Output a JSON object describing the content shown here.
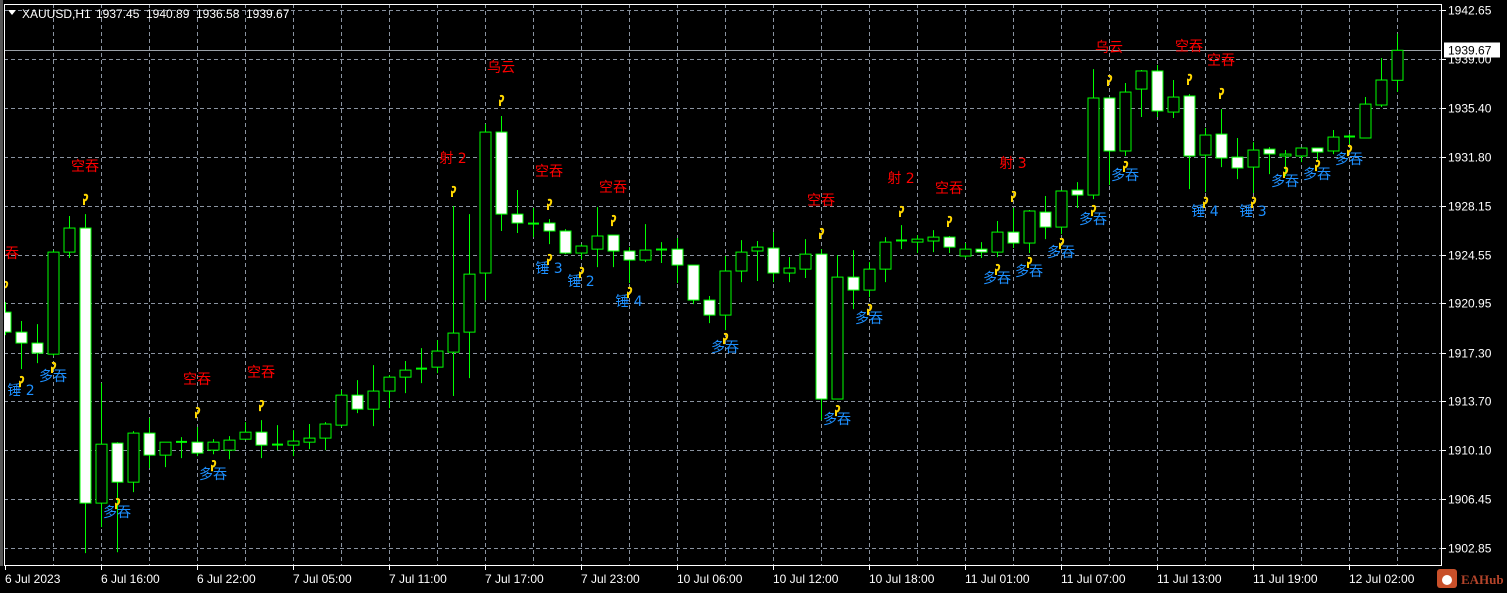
{
  "header": {
    "symbol": "XAUUSD,H1",
    "open": "1937.45",
    "high": "1940.89",
    "low": "1936.58",
    "close": "1939.67"
  },
  "current_price_label": "1939.67",
  "logo_text": "EAHub",
  "colors": {
    "background": "#000000",
    "candle_outline": "#00ff00",
    "bull_fill": "#000000",
    "bear_fill": "#ffffff",
    "grid": "#8a93a0",
    "bear_signal": "#ff0000",
    "bull_signal": "#1e90ff",
    "marker": "#ffd700"
  },
  "chart_data": {
    "type": "candlestick",
    "symbol": "XAUUSD",
    "timeframe": "H1",
    "ylim": [
      1902.85,
      1942.65
    ],
    "price_ticks": [
      "1942.65",
      "1939.00",
      "1935.40",
      "1931.80",
      "1928.15",
      "1924.55",
      "1920.95",
      "1917.30",
      "1913.70",
      "1910.10",
      "1906.45",
      "1902.85"
    ],
    "time_labels": [
      "6 Jul 2023",
      "6 Jul 16:00",
      "6 Jul 22:00",
      "7 Jul 05:00",
      "7 Jul 11:00",
      "7 Jul 17:00",
      "7 Jul 23:00",
      "10 Jul 06:00",
      "10 Jul 12:00",
      "10 Jul 18:00",
      "11 Jul 01:00",
      "11 Jul 07:00",
      "11 Jul 13:00",
      "11 Jul 19:00",
      "12 Jul 02:00"
    ],
    "bars_per_time_label": 6,
    "ohlc": [
      [
        1920.3,
        1921.04,
        1918.6,
        1918.82
      ],
      [
        1918.82,
        1919.64,
        1916.08,
        1918.01
      ],
      [
        1918.01,
        1919.41,
        1916.53,
        1917.27
      ],
      [
        1917.19,
        1924.89,
        1917.05,
        1924.74
      ],
      [
        1924.74,
        1927.41,
        1924.3,
        1926.52
      ],
      [
        1926.52,
        1927.55,
        1902.47,
        1906.17
      ],
      [
        1906.17,
        1915.05,
        1904.39,
        1910.53
      ],
      [
        1910.61,
        1910.68,
        1902.54,
        1907.72
      ],
      [
        1907.72,
        1911.5,
        1906.98,
        1911.35
      ],
      [
        1911.35,
        1912.46,
        1908.76,
        1909.72
      ],
      [
        1909.72,
        1910.68,
        1908.83,
        1910.68
      ],
      [
        1910.68,
        1911.05,
        1909.5,
        1910.7
      ],
      [
        1910.68,
        1911.79,
        1909.65,
        1909.87
      ],
      [
        1910.09,
        1910.9,
        1909.79,
        1910.68
      ],
      [
        1910.09,
        1911.13,
        1909.42,
        1910.83
      ],
      [
        1910.9,
        1912.16,
        1910.9,
        1911.42
      ],
      [
        1911.42,
        1912.31,
        1909.5,
        1910.46
      ],
      [
        1910.46,
        1911.94,
        1910.09,
        1910.5
      ],
      [
        1910.46,
        1911.57,
        1909.65,
        1910.76
      ],
      [
        1910.68,
        1912.02,
        1910.16,
        1910.98
      ],
      [
        1910.98,
        1912.16,
        1910.09,
        1912.02
      ],
      [
        1911.94,
        1914.53,
        1911.79,
        1914.16
      ],
      [
        1914.16,
        1915.27,
        1912.83,
        1913.12
      ],
      [
        1913.12,
        1916.38,
        1911.87,
        1914.46
      ],
      [
        1914.46,
        1915.64,
        1913.2,
        1915.49
      ],
      [
        1915.49,
        1916.68,
        1914.31,
        1916.01
      ],
      [
        1916.08,
        1917.64,
        1915.05,
        1916.12
      ],
      [
        1916.23,
        1918.23,
        1915.79,
        1917.42
      ],
      [
        1917.34,
        1928.15,
        1914.09,
        1918.75
      ],
      [
        1918.82,
        1927.55,
        1915.42,
        1923.11
      ],
      [
        1923.19,
        1934.21,
        1921.19,
        1933.62
      ],
      [
        1933.62,
        1934.81,
        1926.3,
        1927.55
      ],
      [
        1927.55,
        1929.33,
        1926.15,
        1926.89
      ],
      [
        1926.81,
        1928.0,
        1925.85,
        1926.85
      ],
      [
        1926.89,
        1927.18,
        1925.33,
        1926.3
      ],
      [
        1926.3,
        1926.44,
        1924.59,
        1924.67
      ],
      [
        1924.67,
        1925.33,
        1924.22,
        1925.19
      ],
      [
        1924.96,
        1928.07,
        1923.63,
        1925.93
      ],
      [
        1926.0,
        1926.0,
        1923.63,
        1924.82
      ],
      [
        1924.82,
        1925.11,
        1922.45,
        1924.15
      ],
      [
        1924.15,
        1926.81,
        1924.0,
        1924.89
      ],
      [
        1924.89,
        1925.48,
        1923.93,
        1924.93
      ],
      [
        1924.96,
        1925.78,
        1922.45,
        1923.78
      ],
      [
        1923.78,
        1923.78,
        1920.89,
        1921.19
      ],
      [
        1921.19,
        1921.49,
        1919.49,
        1920.08
      ],
      [
        1920.08,
        1924.45,
        1918.97,
        1923.34
      ],
      [
        1923.34,
        1925.63,
        1922.52,
        1924.74
      ],
      [
        1924.82,
        1925.56,
        1922.6,
        1925.11
      ],
      [
        1925.04,
        1926.22,
        1922.52,
        1923.19
      ],
      [
        1923.19,
        1924.37,
        1922.52,
        1923.56
      ],
      [
        1923.48,
        1925.7,
        1922.82,
        1924.59
      ],
      [
        1924.59,
        1924.96,
        1912.31,
        1913.87
      ],
      [
        1913.87,
        1924.52,
        1913.87,
        1922.89
      ],
      [
        1922.89,
        1924.89,
        1920.52,
        1921.93
      ],
      [
        1921.93,
        1924.0,
        1921.41,
        1923.48
      ],
      [
        1923.48,
        1925.85,
        1922.52,
        1925.48
      ],
      [
        1925.56,
        1926.74,
        1924.96,
        1925.6
      ],
      [
        1925.48,
        1926.0,
        1924.67,
        1925.7
      ],
      [
        1925.56,
        1926.37,
        1924.74,
        1925.85
      ],
      [
        1925.85,
        1925.93,
        1924.67,
        1925.11
      ],
      [
        1924.45,
        1925.41,
        1924.3,
        1924.96
      ],
      [
        1924.96,
        1925.48,
        1924.3,
        1924.74
      ],
      [
        1924.74,
        1927.04,
        1924.37,
        1926.22
      ],
      [
        1926.22,
        1928.0,
        1925.04,
        1925.41
      ],
      [
        1925.41,
        1927.85,
        1924.67,
        1927.78
      ],
      [
        1927.7,
        1928.89,
        1925.7,
        1926.59
      ],
      [
        1926.59,
        1929.33,
        1926.07,
        1929.26
      ],
      [
        1929.33,
        1929.92,
        1928.0,
        1928.96
      ],
      [
        1928.96,
        1938.28,
        1928.66,
        1936.14
      ],
      [
        1936.14,
        1936.14,
        1929.7,
        1932.22
      ],
      [
        1932.22,
        1937.25,
        1931.85,
        1936.58
      ],
      [
        1936.8,
        1938.21,
        1934.73,
        1938.14
      ],
      [
        1938.14,
        1938.58,
        1934.73,
        1935.18
      ],
      [
        1935.1,
        1937.47,
        1934.66,
        1936.21
      ],
      [
        1936.29,
        1936.43,
        1929.4,
        1931.85
      ],
      [
        1931.92,
        1933.92,
        1929.18,
        1933.4
      ],
      [
        1933.47,
        1935.32,
        1931.03,
        1931.7
      ],
      [
        1931.77,
        1933.18,
        1930.14,
        1930.96
      ],
      [
        1931.03,
        1932.88,
        1929.11,
        1932.29
      ],
      [
        1932.36,
        1932.51,
        1930.51,
        1932.0
      ],
      [
        1931.85,
        1932.29,
        1930.37,
        1931.99
      ],
      [
        1931.85,
        1932.44,
        1931.4,
        1932.44
      ],
      [
        1932.44,
        1932.44,
        1931.48,
        1932.14
      ],
      [
        1932.22,
        1933.77,
        1931.99,
        1933.25
      ],
      [
        1933.25,
        1933.47,
        1932.73,
        1933.29
      ],
      [
        1933.18,
        1936.21,
        1933.18,
        1935.69
      ],
      [
        1935.62,
        1939.1,
        1935.47,
        1937.47
      ],
      [
        1937.45,
        1940.89,
        1936.58,
        1939.67
      ]
    ],
    "signals": [
      {
        "bar": 0,
        "text": "空吞",
        "type": "bear",
        "price": 1924.67
      },
      {
        "bar": 1,
        "text": "锤 2",
        "type": "bull",
        "price": 1914.53
      },
      {
        "bar": 3,
        "text": "多吞",
        "type": "bull",
        "price": 1915.57
      },
      {
        "bar": 5,
        "text": "空吞",
        "type": "bear",
        "price": 1931.11
      },
      {
        "bar": 7,
        "text": "多吞",
        "type": "bull",
        "price": 1905.5
      },
      {
        "bar": 12,
        "text": "空吞",
        "type": "bear",
        "price": 1915.34
      },
      {
        "bar": 13,
        "text": "多吞",
        "type": "bull",
        "price": 1908.31
      },
      {
        "bar": 16,
        "text": "空吞",
        "type": "bear",
        "price": 1915.86
      },
      {
        "bar": 28,
        "text": "射 2",
        "type": "bear",
        "price": 1931.7
      },
      {
        "bar": 31,
        "text": "乌云",
        "type": "bear",
        "price": 1938.43
      },
      {
        "bar": 34,
        "text": "空吞",
        "type": "bear",
        "price": 1930.74
      },
      {
        "bar": 34,
        "text": "锤 3",
        "type": "bull",
        "price": 1923.56
      },
      {
        "bar": 36,
        "text": "锤 2",
        "type": "bull",
        "price": 1922.6
      },
      {
        "bar": 38,
        "text": "空吞",
        "type": "bear",
        "price": 1929.55
      },
      {
        "bar": 39,
        "text": "锤 4",
        "type": "bull",
        "price": 1921.12
      },
      {
        "bar": 45,
        "text": "多吞",
        "type": "bull",
        "price": 1917.71
      },
      {
        "bar": 51,
        "text": "空吞",
        "type": "bear",
        "price": 1928.59
      },
      {
        "bar": 52,
        "text": "多吞",
        "type": "bull",
        "price": 1912.38
      },
      {
        "bar": 54,
        "text": "多吞",
        "type": "bull",
        "price": 1919.86
      },
      {
        "bar": 56,
        "text": "射 2",
        "type": "bear",
        "price": 1930.22
      },
      {
        "bar": 59,
        "text": "空吞",
        "type": "bear",
        "price": 1929.48
      },
      {
        "bar": 62,
        "text": "多吞",
        "type": "bull",
        "price": 1922.82
      },
      {
        "bar": 63,
        "text": "射 3",
        "type": "bear",
        "price": 1931.33
      },
      {
        "bar": 64,
        "text": "多吞",
        "type": "bull",
        "price": 1923.34
      },
      {
        "bar": 66,
        "text": "多吞",
        "type": "bull",
        "price": 1924.74
      },
      {
        "bar": 68,
        "text": "多吞",
        "type": "bull",
        "price": 1927.18
      },
      {
        "bar": 69,
        "text": "乌云",
        "type": "bear",
        "price": 1939.91
      },
      {
        "bar": 70,
        "text": "多吞",
        "type": "bull",
        "price": 1930.44
      },
      {
        "bar": 74,
        "text": "空吞",
        "type": "bear",
        "price": 1939.99
      },
      {
        "bar": 75,
        "text": "锤 4",
        "type": "bull",
        "price": 1927.78
      },
      {
        "bar": 76,
        "text": "空吞",
        "type": "bear",
        "price": 1938.95
      },
      {
        "bar": 78,
        "text": "锤 3",
        "type": "bull",
        "price": 1927.78
      },
      {
        "bar": 80,
        "text": "多吞",
        "type": "bull",
        "price": 1930.0
      },
      {
        "bar": 82,
        "text": "多吞",
        "type": "bull",
        "price": 1930.51
      },
      {
        "bar": 84,
        "text": "多吞",
        "type": "bull",
        "price": 1931.62
      }
    ]
  }
}
